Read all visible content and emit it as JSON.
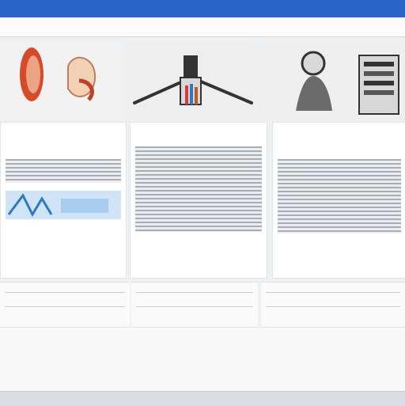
{
  "colors": {
    "titlebar": "#2b63c7",
    "accent": "#8b2f72",
    "gauge": "#2f78c4"
  },
  "toolbar": {
    "item_1": "",
    "item_2": "",
    "item_3": "",
    "item_4": ""
  },
  "banner": {
    "left_caption": "",
    "middle_label": "",
    "right_label": ""
  },
  "panels": {
    "left_title": "",
    "left_caption": "",
    "center_title": "",
    "center_button": "",
    "right_title": ""
  },
  "rows": {
    "left_text": "",
    "center_text": "",
    "right_text": ""
  },
  "bottom": {
    "left_label": "",
    "left_icon": "",
    "center_brand": "",
    "center_sub": "",
    "right_label": ""
  },
  "icons": {
    "close": "close-icon",
    "gauge": "gauge-icon",
    "drone": "drone-icon",
    "camera": "camera-icon",
    "machine": "machine-icon"
  }
}
